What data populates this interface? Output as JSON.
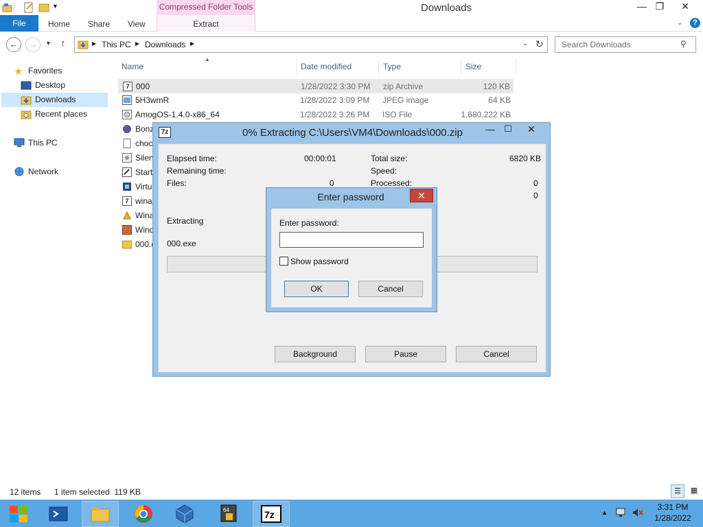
{
  "window": {
    "title": "Downloads",
    "context_tab": "Compressed Folder Tools",
    "minimize": "—",
    "maximize": "❐",
    "close": "✕"
  },
  "ribbon": {
    "file": "File",
    "tabs": [
      "Home",
      "Share",
      "View"
    ],
    "extract": "Extract"
  },
  "address": {
    "path": [
      "This PC",
      "Downloads"
    ],
    "search_placeholder": "Search Downloads"
  },
  "nav": {
    "favorites": "Favorites",
    "desktop": "Desktop",
    "downloads": "Downloads",
    "recent": "Recent places",
    "thispc": "This PC",
    "network": "Network"
  },
  "columns": {
    "name": "Name",
    "date": "Date modified",
    "type": "Type",
    "size": "Size"
  },
  "files": [
    {
      "name": "000",
      "date": "1/28/2022 3:30 PM",
      "type": "zip Archive",
      "size": "120 KB",
      "icon": "7zip-archive-icon"
    },
    {
      "name": "5H3wmR",
      "date": "1/28/2022 3:09 PM",
      "type": "JPEG image",
      "size": "64 KB",
      "icon": "image-icon"
    },
    {
      "name": "AmogOS-1.4.0-x86_64",
      "date": "1/28/2022 3:26 PM",
      "type": "ISO File",
      "size": "1,680,222 KB",
      "icon": "iso-file-icon"
    },
    {
      "name": "Bonz",
      "icon": "bonzi-icon"
    },
    {
      "name": "choc",
      "icon": "document-icon"
    },
    {
      "name": "Silen",
      "icon": "installer-icon"
    },
    {
      "name": "Start",
      "icon": "shortcut-icon"
    },
    {
      "name": "Virtu",
      "icon": "virtualbox-icon"
    },
    {
      "name": "wina",
      "icon": "7zip-archive-icon"
    },
    {
      "name": "Wina",
      "icon": "winamp-icon"
    },
    {
      "name": "Wind",
      "icon": "windows-installer-icon"
    },
    {
      "name": "000.e",
      "icon": "folder-icon"
    }
  ],
  "extract_dialog": {
    "title": "0% Extracting C:\\Users\\VM4\\Downloads\\000.zip",
    "elapsed_label": "Elapsed time:",
    "elapsed_value": "00:00:01",
    "remaining_label": "Remaining time:",
    "files_label": "Files:",
    "files_value": "0",
    "total_size_label": "Total size:",
    "total_size_value": "6820 KB",
    "speed_label": "Speed:",
    "processed_label": "Processed:",
    "processed_value": "0",
    "extra_value": "0",
    "extracting_label": "Extracting",
    "current_file": "000.exe",
    "progress": 0,
    "btn_background": "Background",
    "btn_pause": "Pause",
    "btn_cancel": "Cancel"
  },
  "password_dialog": {
    "title": "Enter password",
    "prompt": "Enter password:",
    "value": "",
    "show_password": "Show password",
    "ok": "OK",
    "cancel": "Cancel"
  },
  "status": {
    "items": "12 items",
    "selected": "1 item selected  119 KB"
  },
  "clock": {
    "time": "3:31 PM",
    "date": "1/28/2022"
  }
}
